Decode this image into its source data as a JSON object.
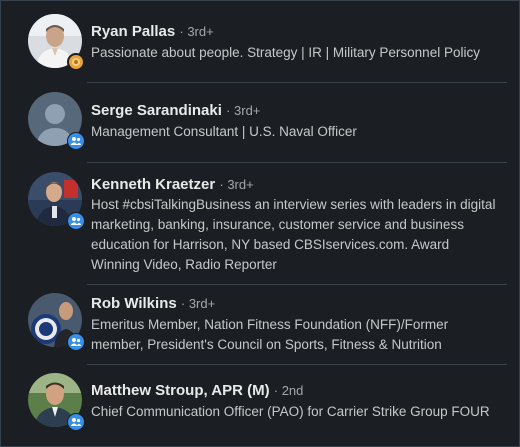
{
  "connections": [
    {
      "name": "Ryan Pallas",
      "degree": "· 3rd+",
      "headline": "Passionate about people. Strategy | IR | Military Personnel Policy",
      "badge": "gold-ring-icon",
      "colors": {
        "badge": "#e7a33e"
      }
    },
    {
      "name": "Serge Sarandinaki",
      "degree": "· 3rd+",
      "headline": "Management Consultant | U.S. Naval Officer",
      "badge": "linkedin-contact-icon",
      "colors": {
        "badge": "#378fe9"
      }
    },
    {
      "name": "Kenneth Kraetzer",
      "degree": "· 3rd+",
      "headline": "Host #cbsiTalkingBusiness an interview series with leaders in digital marketing, banking, insurance, customer service and business education for Harrison, NY based CBSIservices.com. Award Winning Video, Radio Reporter",
      "badge": "linkedin-contact-icon",
      "colors": {
        "badge": "#378fe9"
      }
    },
    {
      "name": "Rob Wilkins",
      "degree": "· 3rd+",
      "headline": "Emeritus Member, Nation Fitness Foundation (NFF)/Former member, President's Council on Sports, Fitness & Nutrition",
      "badge": "linkedin-contact-icon",
      "colors": {
        "badge": "#378fe9"
      }
    },
    {
      "name": "Matthew Stroup, APR (M)",
      "degree": "· 2nd",
      "headline": "Chief Communication Officer (PAO) for Carrier Strike Group FOUR",
      "badge": "linkedin-contact-icon",
      "colors": {
        "badge": "#378fe9"
      }
    }
  ],
  "theme": {
    "background": "#1b1f23",
    "divider": "#38434f",
    "text": "#ffffffe6"
  }
}
